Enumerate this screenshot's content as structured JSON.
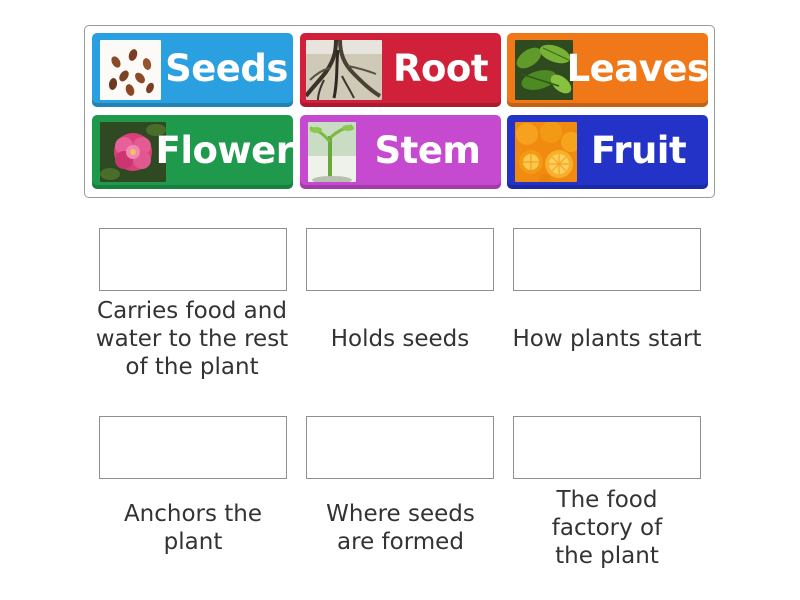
{
  "tiles": [
    {
      "label": "Seeds",
      "color": "#2aa0e0",
      "image": "seeds-image"
    },
    {
      "label": "Root",
      "color": "#d1203a",
      "image": "root-image"
    },
    {
      "label": "Leaves",
      "color": "#f07818",
      "image": "leaves-image"
    },
    {
      "label": "Flower",
      "color": "#1f9a4c",
      "image": "flower-image"
    },
    {
      "label": "Stem",
      "color": "#c64ad0",
      "image": "stem-image"
    },
    {
      "label": "Fruit",
      "color": "#2333c8",
      "image": "fruit-image"
    }
  ],
  "targets": [
    {
      "clue": "Carries food and water to the rest of the plant"
    },
    {
      "clue": "Holds seeds"
    },
    {
      "clue": "How plants start"
    },
    {
      "clue": "Anchors the plant"
    },
    {
      "clue": "Where seeds are formed"
    },
    {
      "clue": "The food factory of the plant"
    }
  ]
}
